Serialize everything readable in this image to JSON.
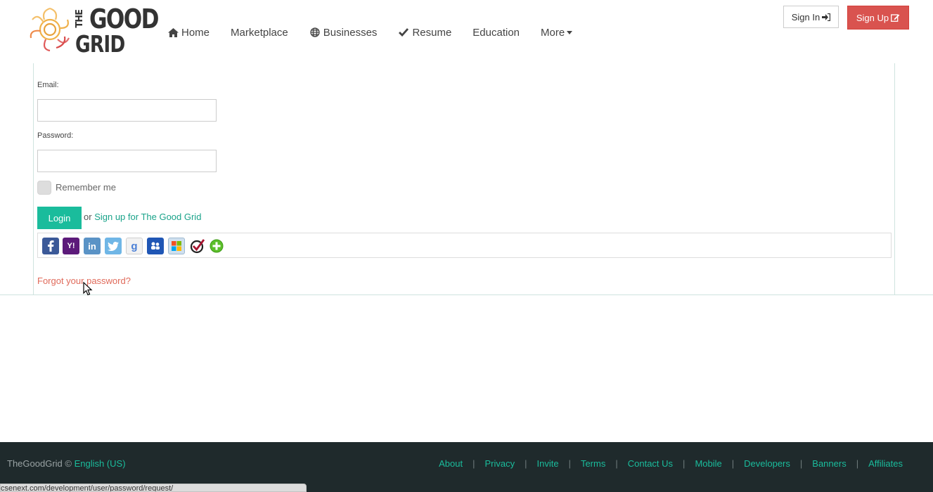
{
  "header": {
    "logo": {
      "line1": "THE",
      "line2": "GOOD",
      "line3": "GRID"
    },
    "nav": [
      {
        "label": "Home",
        "icon": "home-icon"
      },
      {
        "label": "Marketplace",
        "icon": ""
      },
      {
        "label": "Businesses",
        "icon": "globe-icon"
      },
      {
        "label": "Resume",
        "icon": "check-icon"
      },
      {
        "label": "Education",
        "icon": ""
      },
      {
        "label": "More",
        "icon": "caret-down-icon"
      }
    ],
    "sign_in": "Sign In",
    "sign_up": "Sign Up"
  },
  "login": {
    "email_label": "Email:",
    "email_value": "",
    "password_label": "Password:",
    "password_value": "",
    "remember_label": "Remember me",
    "login_button": "Login",
    "or_text": "or",
    "signup_link": "Sign up for The Good Grid",
    "social_providers": [
      "facebook",
      "yahoo",
      "linkedin",
      "twitter",
      "google",
      "windows-live",
      "microsoft",
      "verisign",
      "more"
    ],
    "social_yahoo_glyph": "Y!",
    "social_linkedin_glyph": "in",
    "social_google_glyph": "g",
    "forgot_link": "Forgot your password?"
  },
  "footer": {
    "brand": "TheGoodGrid ©",
    "language": "English (US)",
    "links": [
      "About",
      "Privacy",
      "Invite",
      "Terms",
      "Contact Us",
      "Mobile",
      "Developers",
      "Banners",
      "Affiliates"
    ]
  },
  "status_url": "csenext.com/development/user/password/request/",
  "colors": {
    "accent": "#1abc9c",
    "danger": "#d9534f",
    "footer_bg": "#1f2a2c",
    "link_red": "#e06a5a"
  }
}
